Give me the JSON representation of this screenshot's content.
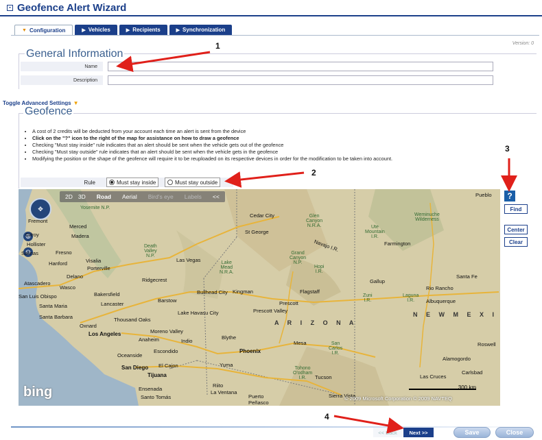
{
  "window": {
    "title": "Geofence Alert Wizard",
    "title_icon": "collapse-icon"
  },
  "tabs": [
    {
      "label": "Configuration",
      "active": true
    },
    {
      "label": "Vehicles",
      "active": false
    },
    {
      "label": "Recipients",
      "active": false
    },
    {
      "label": "Synchronization",
      "active": false
    }
  ],
  "version": "Version: 0",
  "general": {
    "title": "General Information",
    "name_label": "Name",
    "name_value": "",
    "description_label": "Description",
    "description_value": ""
  },
  "toggle_advanced": "Toggle Advanced Settings",
  "geofence": {
    "title": "Geofence",
    "bullets": [
      "A cost of 2 credits will be deducted from your account each time an alert is sent from the device",
      "Click on the \"?\" icon to the right of the map for assistance on how to draw a geofence",
      "Checking \"Must stay inside\" rule indicates that an alert should be sent when the vehicle gets out of the geofence",
      "Checking \"Must stay outside\" rule indicates that an alert should be sent when the vehicle gets in the geofence",
      "Modifying the position or the shape of the geofence will require it to be reuploaded on its respective devices in order for the modification to be taken into account."
    ],
    "rule_label": "Rule",
    "rule_inside": "Must stay inside",
    "rule_outside": "Must stay outside",
    "rule_selected": "inside"
  },
  "map": {
    "toolbar": {
      "2d": "2D",
      "3d": "3D",
      "road": "Road",
      "aerial": "Aerial",
      "birdseye": "Bird's eye",
      "labels": "Labels",
      "collapse": "<<"
    },
    "logo": "bing",
    "copyright": "© 2009 Microsoft Corporation    © 2009 NAVTEQ",
    "scale": "300 km",
    "labels": {
      "yosemite": "Yosemite\nN.P.",
      "fremont": "Fremont",
      "merced": "Merced",
      "gilroy": "Gilroy",
      "madera": "Madera",
      "hollister": "Hollister",
      "salinas": "Salinas",
      "fresno": "Fresno",
      "visalia": "Visalia",
      "hanford": "Hanford",
      "porterville": "Porterville",
      "delano": "Delano",
      "ridgecrest": "Ridgecrest",
      "atascadero": "Atascadero",
      "wasco": "Wasco",
      "bakersfield": "Bakersfield",
      "slo": "San Luis Obispo",
      "santamaria": "Santa Maria",
      "lancaster": "Lancaster",
      "barstow": "Barstow",
      "santabarbara": "Santa Barbara",
      "oxnard": "Oxnard",
      "thousandoaks": "Thousand Oaks",
      "la": "Los Angeles",
      "morenovalley": "Moreno Valley",
      "anaheim": "Anaheim",
      "indio": "Indio",
      "oceanside": "Oceanside",
      "escondido": "Escondido",
      "sandiego": "San Diego",
      "elcajon": "El Cajon",
      "tijuana": "Tijuana",
      "ensenada": "Ensenada",
      "santotomas": "Santo Tomás",
      "deathvalley": "Death\nValley\nN.P.",
      "lasvegas": "Las Vegas",
      "lakemead": "Lake\nMead\nN.R.A.",
      "cedarcity": "Cedar City",
      "stgeorge": "St George",
      "glencanyon": "Glen\nCanyon\nN.R.A.",
      "grandcanyon": "Grand\nCanyon\nN.P.",
      "navajo": "Navajo I.R.",
      "hopi": "Hopi\nI.R.",
      "bullhead": "Bullhead City",
      "kingman": "Kingman",
      "flagstaff": "Flagstaff",
      "prescott": "Prescott",
      "prescottvalley": "Prescott Valley",
      "lakehavasu": "Lake Havasu City",
      "arizona": "A R I Z O N A",
      "blythe": "Blythe",
      "mesa": "Mesa",
      "phoenix": "Phoenix",
      "sancarlos": "San\nCarlos\nI.R.",
      "yuma": "Yuma",
      "tohono": "Tohono\nO'odham\nI.R.",
      "tucson": "Tucson",
      "sierravista": "Sierra Vista",
      "puertopenasco": "Puerto\nPeñasco",
      "riito": "Riito",
      "laventana": "La Ventana",
      "ute": "Ute\nMountain\nI.R.",
      "farmington": "Farmington",
      "weminuche": "Weminuche\nWilderness",
      "pueblo": "Pueblo",
      "gallup": "Gallup",
      "santafe": "Santa Fe",
      "riorancho": "Rio Rancho",
      "zuni": "Zuni\nI.R.",
      "laguna": "Laguna\nI.R.",
      "albuquerque": "Albuquerque",
      "newmexico": "N E W   M E X I C O",
      "roswell": "Roswell",
      "alamogordo": "Alamogordo",
      "lascruces": "Las Cruces",
      "carlsbad": "Carlsbad"
    }
  },
  "side_buttons": {
    "help": "?",
    "find": "Find",
    "center": "Center",
    "clear": "Clear"
  },
  "footer": {
    "back": "<< Back",
    "next": "Next >>",
    "save": "Save",
    "close": "Close"
  },
  "annotations": [
    "1",
    "2",
    "3",
    "4"
  ],
  "colors": {
    "brand": "#1b3f8a",
    "accent": "#e08a00",
    "annotation_arrow": "#e0201a"
  }
}
